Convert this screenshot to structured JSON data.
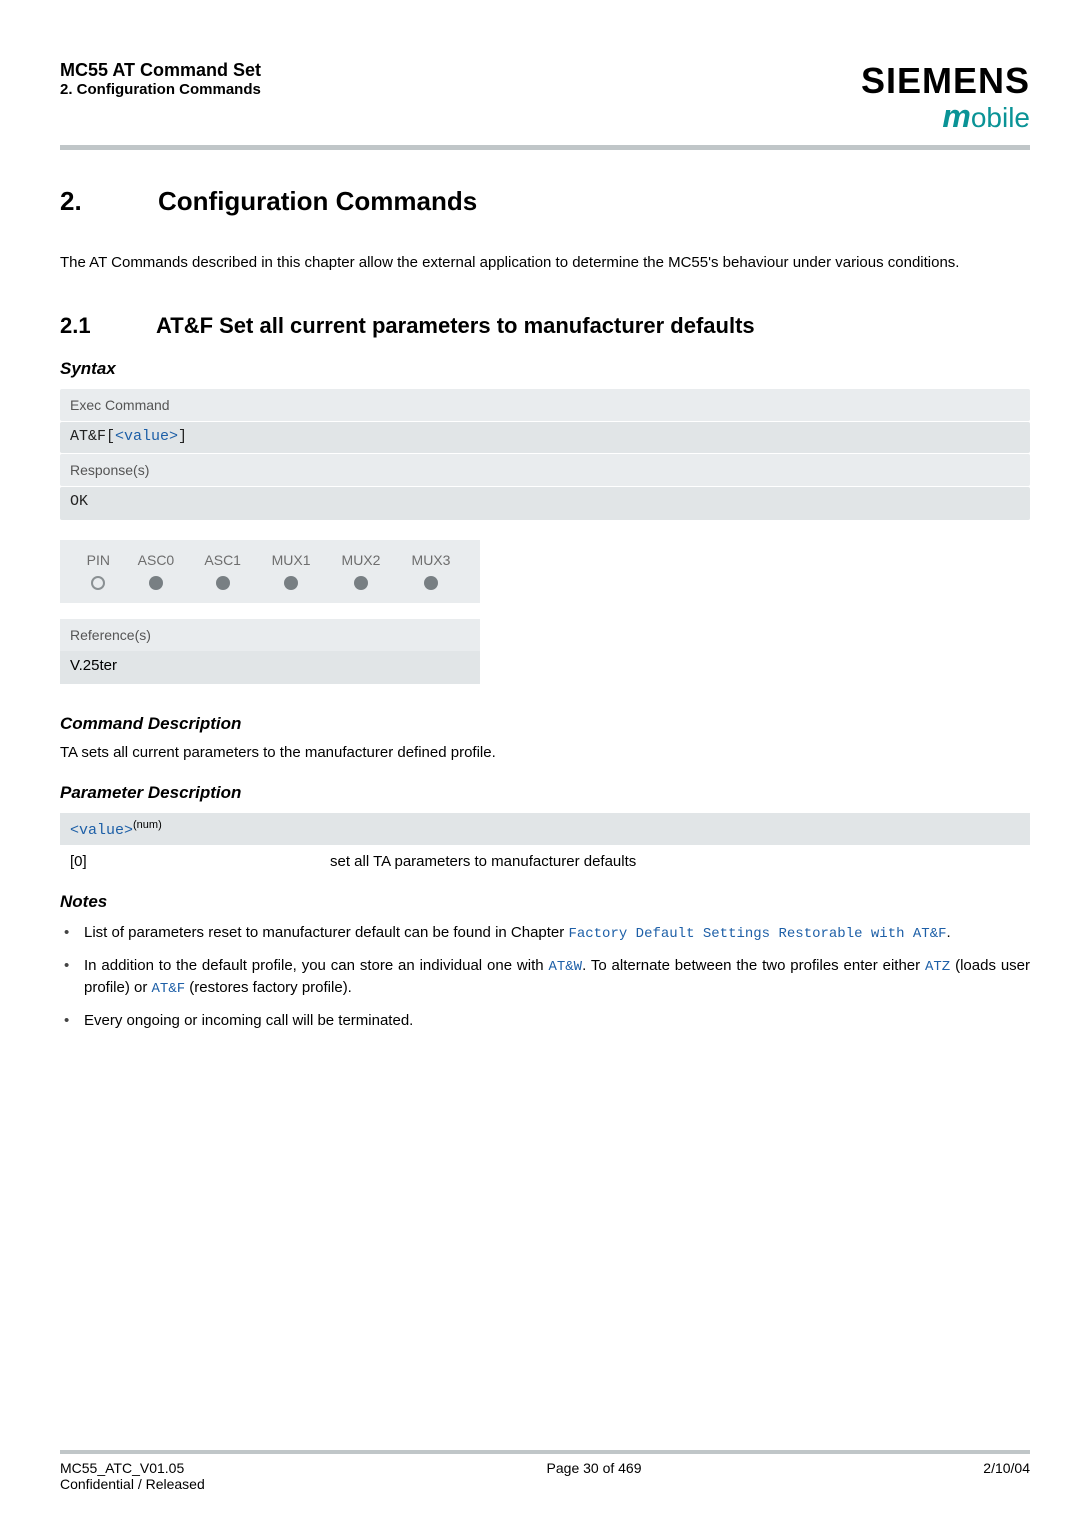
{
  "header": {
    "title": "MC55 AT Command Set",
    "subtitle": "2. Configuration Commands",
    "brand": "SIEMENS",
    "brand_sub_m": "m",
    "brand_sub_rest": "obile"
  },
  "h1": {
    "num": "2.",
    "text": "Configuration Commands"
  },
  "intro": "The AT Commands described in this chapter allow the external application to determine the MC55's behaviour under various conditions.",
  "h2": {
    "num": "2.1",
    "text": "AT&F   Set all current parameters to manufacturer defaults"
  },
  "syntax_label": "Syntax",
  "syntax": {
    "exec_label": "Exec Command",
    "exec_cmd_prefix": "AT&F[",
    "exec_cmd_param": "<value>",
    "exec_cmd_suffix": "]",
    "resp_label": "Response(s)",
    "resp_body": "OK"
  },
  "matrix": {
    "cols": [
      "PIN",
      "ASC0",
      "ASC1",
      "MUX1",
      "MUX2",
      "MUX3"
    ],
    "state": [
      "empty",
      "filled",
      "filled",
      "filled",
      "filled",
      "filled"
    ]
  },
  "reference": {
    "label": "Reference(s)",
    "value": "V.25ter"
  },
  "cmd_desc_label": "Command Description",
  "cmd_desc": "TA sets all current parameters to the manufacturer defined profile.",
  "param_desc_label": "Parameter Description",
  "param": {
    "name": "<value>",
    "sup": "(num)",
    "key": "[0]",
    "desc": "set all TA parameters to manufacturer defaults"
  },
  "notes_label": "Notes",
  "notes": {
    "n1_a": "List of parameters reset to manufacturer default can be found in Chapter ",
    "n1_link": "Factory Default Settings Restorable with AT&F",
    "n1_b": ".",
    "n2_a": "In addition to the default profile, you can store an individual one with ",
    "n2_l1": "AT&W",
    "n2_b": ". To alternate between the two profiles enter either ",
    "n2_l2": "ATZ",
    "n2_c": " (loads user profile) or ",
    "n2_l3": "AT&F",
    "n2_d": " (restores factory profile).",
    "n3": "Every ongoing or incoming call will be terminated."
  },
  "footer": {
    "left1": "MC55_ATC_V01.05",
    "left2": "Confidential / Released",
    "center": "Page 30 of 469",
    "right": "2/10/04"
  }
}
